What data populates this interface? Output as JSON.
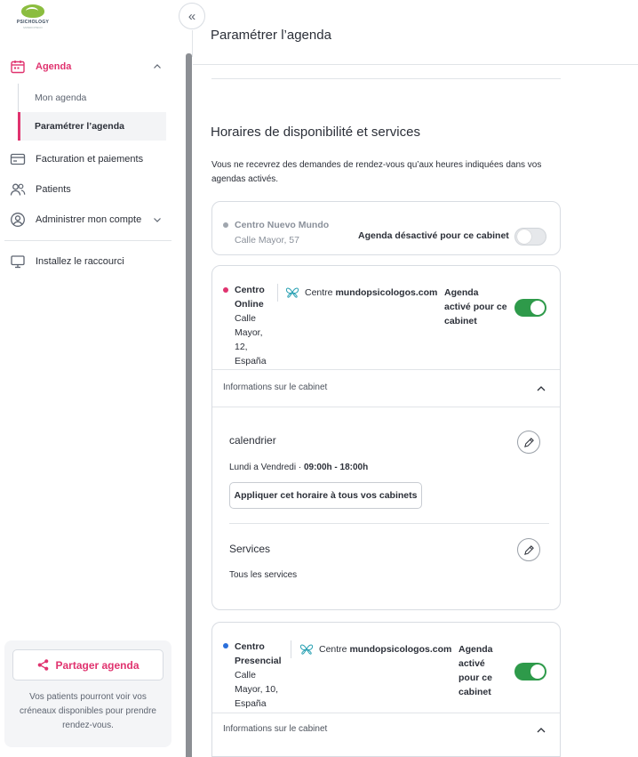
{
  "logo": {
    "text": "PSICHOLOGY",
    "sub": "MUNDO PSICO"
  },
  "sidebar": {
    "agenda_label": "Agenda",
    "sub_items": [
      "Mon agenda",
      "Paramétrer l’agenda"
    ],
    "billing_label": "Facturation et paiements",
    "patients_label": "Patients",
    "account_label": "Administrer mon compte",
    "shortcut_label": "Installez le raccourci",
    "share_button": "Partager agenda",
    "share_desc": "Vos patients pourront voir vos créneaux disponibles pour prendre rendez-vous."
  },
  "colors": {
    "accent": "#e0336f",
    "toggle_on": "#2e9a4a",
    "dot_gray": "#a0a6ae",
    "dot_blue": "#2a6fdb"
  },
  "main": {
    "page_title": "Paramétrer l’agenda",
    "section_title": "Horaires de disponibilité et services",
    "section_desc": "Vous ne recevrez des demandes de rendez-vous qu’aux heures indiquées dans vos agendas activés.",
    "cabinets": [
      {
        "name": "Centro Nuevo Mundo",
        "address": "Calle Mayor, 57",
        "status": "Agenda désactivé pour ce cabinet",
        "enabled": false
      },
      {
        "name_l1": "Centro",
        "name_l2": "Online",
        "address_lines": [
          "Calle",
          "Mayor,",
          "12,",
          "España"
        ],
        "centre_prefix": "Centre ",
        "centre_name": "mundopsicologos.com",
        "status_lines": [
          "Agenda",
          "activé pour ce",
          "cabinet"
        ],
        "enabled": true,
        "info_label": "Informations sur le cabinet",
        "calendar_title": "calendrier",
        "calendar_days": "Lundi a Vendredi ·",
        "calendar_hours": "09:00h - 18:00h",
        "apply_button": "Appliquer cet horaire à tous vos cabinets",
        "services_title": "Services",
        "services_value": "Tous les services"
      },
      {
        "name_l1": "Centro",
        "name_l2": "Presencial",
        "address_lines": [
          "Calle",
          "Mayor, 10,",
          "España"
        ],
        "centre_prefix": "Centre ",
        "centre_name": "mundopsicologos.com",
        "status_lines": [
          "Agenda",
          "activé",
          "pour ce",
          "cabinet"
        ],
        "enabled": true,
        "info_label": "Informations sur le cabinet"
      }
    ]
  }
}
